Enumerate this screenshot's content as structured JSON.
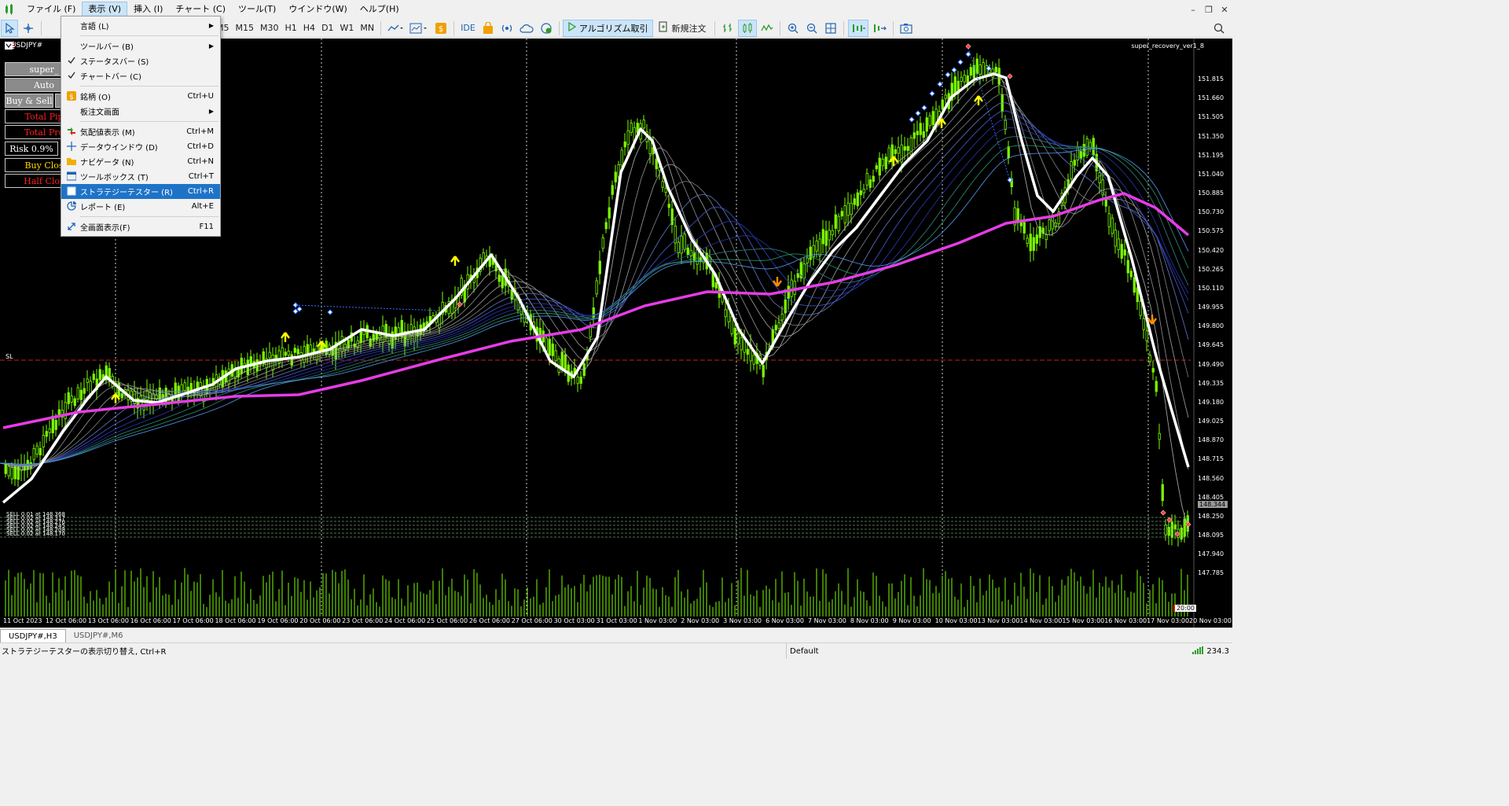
{
  "menu": {
    "items": [
      "ファイル (F)",
      "表示 (V)",
      "挿入 (I)",
      "チャート (C)",
      "ツール(T)",
      "ウインドウ(W)",
      "ヘルプ(H)"
    ],
    "active_index": 1
  },
  "toolbar": {
    "timeframes": [
      "M5",
      "M15",
      "M30",
      "H1",
      "H4",
      "D1",
      "W1",
      "MN"
    ],
    "ide_label": "IDE",
    "algo_label": "アルゴリズム取引",
    "new_order_label": "新規注文"
  },
  "dropdown": {
    "items": [
      {
        "label": "言語 (L)",
        "shortcut": "",
        "submenu": true,
        "icon": "",
        "checked": false
      },
      {
        "sep": true
      },
      {
        "label": "ツールバー (B)",
        "shortcut": "",
        "submenu": true,
        "icon": "",
        "checked": false
      },
      {
        "label": "ステータスバー (S)",
        "shortcut": "",
        "submenu": false,
        "icon": "",
        "checked": true
      },
      {
        "label": "チャートバー (C)",
        "shortcut": "",
        "submenu": false,
        "icon": "",
        "checked": true
      },
      {
        "sep": true
      },
      {
        "label": "銘柄 (O)",
        "shortcut": "Ctrl+U",
        "submenu": false,
        "icon": "symbols-icon",
        "checked": false
      },
      {
        "label": "板注文画面",
        "shortcut": "",
        "submenu": true,
        "icon": "",
        "checked": false
      },
      {
        "sep": true
      },
      {
        "label": "気配値表示 (M)",
        "shortcut": "Ctrl+M",
        "submenu": false,
        "icon": "market-watch-icon",
        "checked": false
      },
      {
        "label": "データウインドウ (D)",
        "shortcut": "Ctrl+D",
        "submenu": false,
        "icon": "data-window-icon",
        "checked": false
      },
      {
        "label": "ナビゲータ (N)",
        "shortcut": "Ctrl+N",
        "submenu": false,
        "icon": "navigator-icon",
        "checked": false
      },
      {
        "label": "ツールボックス (T)",
        "shortcut": "Ctrl+T",
        "submenu": false,
        "icon": "toolbox-icon",
        "checked": false
      },
      {
        "label": "ストラテジーテスター (R)",
        "shortcut": "Ctrl+R",
        "submenu": false,
        "icon": "strategy-tester-icon",
        "checked": false,
        "selected": true
      },
      {
        "label": "レポート (E)",
        "shortcut": "Alt+E",
        "submenu": false,
        "icon": "report-icon",
        "checked": false
      },
      {
        "sep": true
      },
      {
        "label": "全画面表示(F)",
        "shortcut": "F11",
        "submenu": false,
        "icon": "fullscreen-icon",
        "checked": false
      }
    ]
  },
  "chart": {
    "symbol": "USDJPY#",
    "indicator_name": "super_recovery_ver1_8",
    "sl_label": "SL",
    "current_time": "20:00",
    "ea_buttons": [
      "super_",
      "Auto",
      "Buy & Sell",
      "Total Pip",
      "Total Pro",
      "Risk 0.9%",
      "Buy Clos",
      "Half Clos"
    ],
    "price_ticks": [
      "151.815",
      "151.660",
      "151.505",
      "151.350",
      "151.195",
      "151.040",
      "150.885",
      "150.730",
      "150.575",
      "150.420",
      "150.265",
      "150.110",
      "149.955",
      "149.800",
      "149.645",
      "149.490",
      "149.335",
      "149.180",
      "149.025",
      "148.870",
      "148.715",
      "148.560",
      "148.405",
      "148.344",
      "148.250",
      "148.095",
      "147.940",
      "147.785"
    ],
    "current_price": "148.344",
    "time_ticks": [
      "11 Oct 2023",
      "12 Oct 06:00",
      "13 Oct 06:00",
      "16 Oct 06:00",
      "17 Oct 06:00",
      "18 Oct 06:00",
      "19 Oct 06:00",
      "20 Oct 06:00",
      "23 Oct 06:00",
      "24 Oct 06:00",
      "25 Oct 06:00",
      "26 Oct 06:00",
      "27 Oct 06:00",
      "30 Oct 03:00",
      "31 Oct 03:00",
      "1 Nov 03:00",
      "2 Nov 03:00",
      "3 Nov 03:00",
      "6 Nov 03:00",
      "7 Nov 03:00",
      "8 Nov 03:00",
      "9 Nov 03:00",
      "10 Nov 03:00",
      "13 Nov 03:00",
      "14 Nov 03:00",
      "15 Nov 03:00",
      "16 Nov 03:00",
      "17 Nov 03:00",
      "20 Nov 03:00"
    ],
    "sell_orders": [
      "SELL 0.01 at 148.368",
      "SELL 0.02 at 148.317",
      "SELL 0.02 at 148.276",
      "SELL 0.02 at 148.245",
      "SELL 0.02 at 148.208",
      "SELL 0.02 at 148.170"
    ]
  },
  "tabs": [
    "USDJPY#,H3",
    "USDJPY#,M6"
  ],
  "active_tab": 0,
  "status": {
    "text": "ストラテジーテスターの表示切り替え, Ctrl+R",
    "profile": "Default",
    "ping": "234.3"
  },
  "colors": {
    "candle": "#7CFC00",
    "wma_fast": "#ffffff",
    "wma_slow": "#e63ce6",
    "arrow_up": "#ffff00",
    "arrow_down": "#ff8c00",
    "selected_menu": "#1e73c7"
  }
}
